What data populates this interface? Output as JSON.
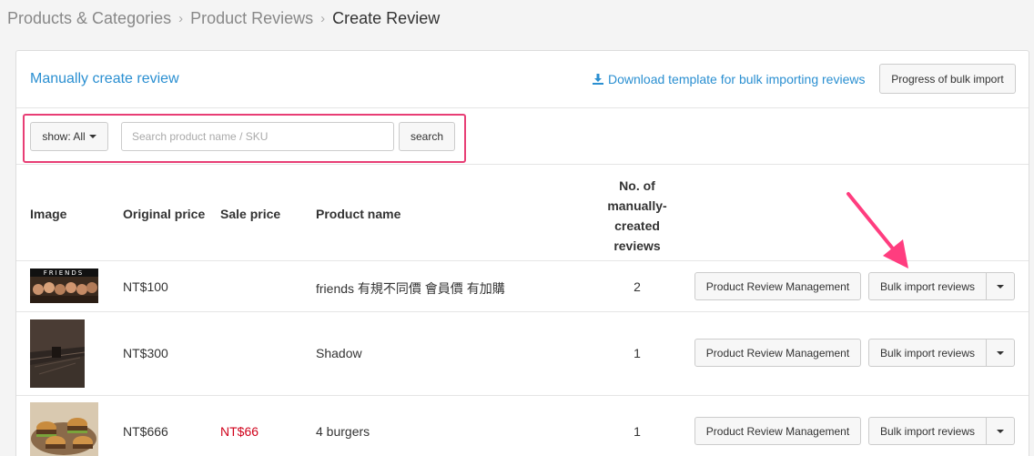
{
  "breadcrumb": {
    "items": [
      "Products & Categories",
      "Product Reviews"
    ],
    "current": "Create Review"
  },
  "header": {
    "manual_link": "Manually create review",
    "download_link": "Download template for bulk importing reviews",
    "progress_button": "Progress of bulk import"
  },
  "filter": {
    "show_label": "show: All",
    "search_placeholder": "Search product name / SKU",
    "search_value": "",
    "search_button": "search"
  },
  "table": {
    "columns": {
      "image": "Image",
      "original_price": "Original price",
      "sale_price": "Sale price",
      "product_name": "Product name",
      "reviews_count": [
        "No. of",
        "manually-",
        "created",
        "reviews"
      ]
    },
    "rows": [
      {
        "image": "friends",
        "original_price": "NT$100",
        "sale_price": "",
        "product_name": "friends 有規不同價 會員價 有加購",
        "reviews_count": "2"
      },
      {
        "image": "shadow",
        "original_price": "NT$300",
        "sale_price": "",
        "product_name": "Shadow",
        "reviews_count": "1"
      },
      {
        "image": "burgers",
        "original_price": "NT$666",
        "sale_price": "NT$66",
        "product_name": "4 burgers",
        "reviews_count": "1"
      }
    ],
    "actions": {
      "management_button": "Product Review Management",
      "bulk_button": "Bulk import reviews"
    }
  },
  "colors": {
    "link": "#2a8fd1",
    "highlight": "#e83e75",
    "sale_price": "#d0021b"
  },
  "icons": {
    "download": "download-icon",
    "caret": "caret-down-icon",
    "annotation": "pink-arrow-icon"
  }
}
